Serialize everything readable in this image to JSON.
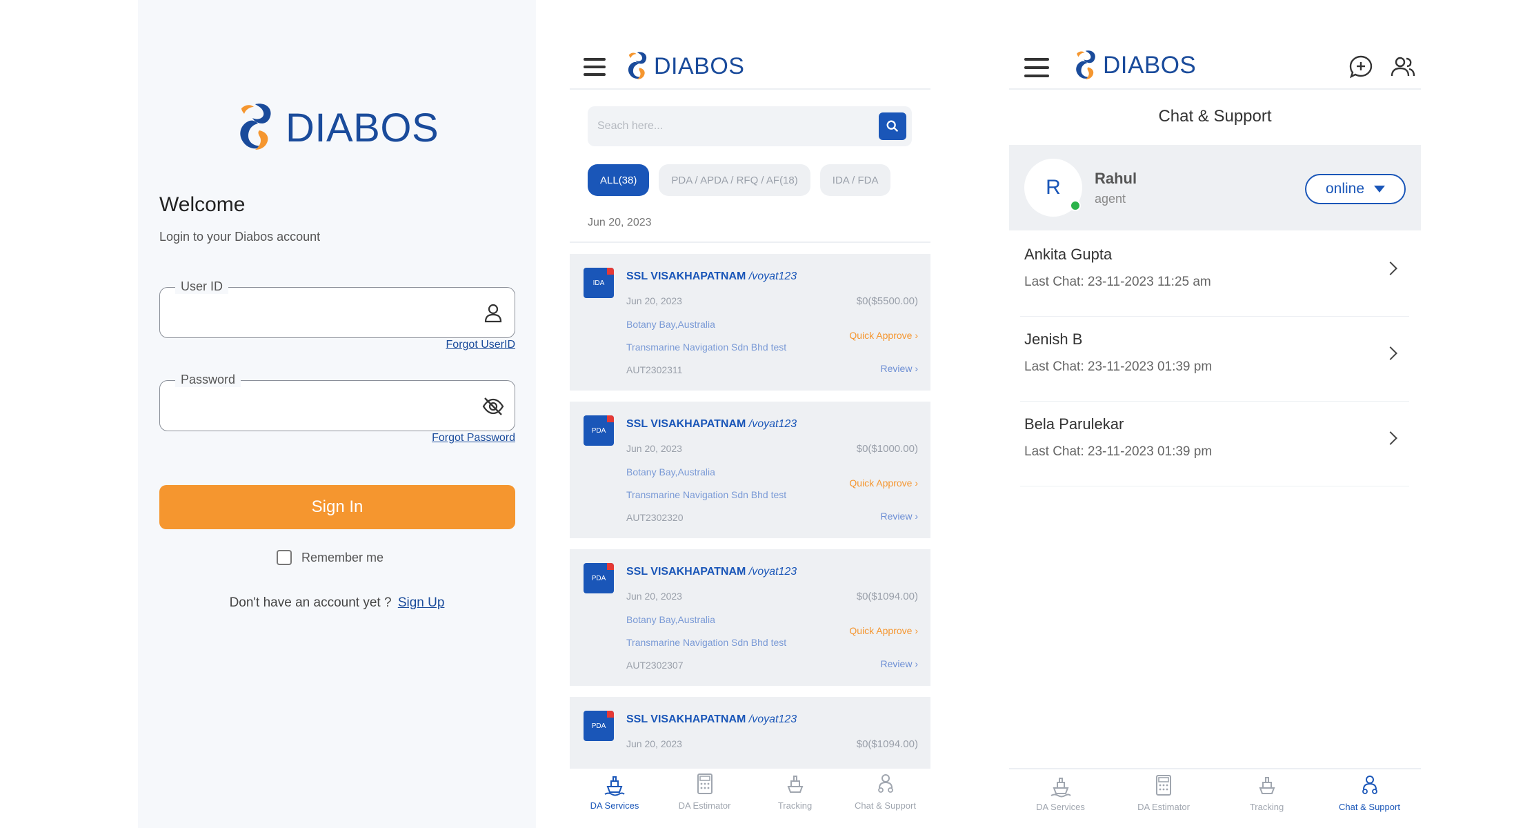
{
  "colors": {
    "brand_blue": "#1a4b9b",
    "accent_blue": "#1a56b8",
    "orange": "#f5962f",
    "online_green": "#2bb34a",
    "bg_light": "#f6f8fb",
    "card_bg": "#eef0f3"
  },
  "logo": {
    "text": "DIABOS"
  },
  "login": {
    "welcome": "Welcome",
    "subtitle": "Login to your Diabos account",
    "userid_label": "User ID",
    "userid_icon": "user-icon",
    "forgot_userid": "Forgot UserID",
    "password_label": "Password",
    "password_icon": "eye-off-icon",
    "forgot_password": "Forgot Password",
    "signin": "Sign In",
    "remember": "Remember me",
    "no_account": "Don't have an account yet ?",
    "signup": "Sign Up"
  },
  "services": {
    "search_placeholder": "Seach here...",
    "filters": [
      "ALL(38)",
      "PDA / APDA / RFQ / AF(18)",
      "IDA / FDA"
    ],
    "date": "Jun 20, 2023",
    "cards": [
      {
        "badge": "IDA",
        "port": "SSL VISAKHAPATNAM",
        "voyage": "/voyat123",
        "date": "Jun 20, 2023",
        "amount": "$0($5500.00)",
        "location": "Botany Bay,Australia",
        "company": "Transmarine Navigation Sdn Bhd test",
        "ref": "AUT2302311",
        "approve": "Quick Approve ›",
        "review": "Review ›"
      },
      {
        "badge": "PDA",
        "port": "SSL VISAKHAPATNAM",
        "voyage": "/voyat123",
        "date": "Jun 20, 2023",
        "amount": "$0($1000.00)",
        "location": "Botany Bay,Australia",
        "company": "Transmarine Navigation Sdn Bhd test",
        "ref": "AUT2302320",
        "approve": "Quick Approve ›",
        "review": "Review ›"
      },
      {
        "badge": "PDA",
        "port": "SSL VISAKHAPATNAM",
        "voyage": "/voyat123",
        "date": "Jun 20, 2023",
        "amount": "$0($1094.00)",
        "location": "Botany Bay,Australia",
        "company": "Transmarine Navigation Sdn Bhd test",
        "ref": "AUT2302307",
        "approve": "Quick Approve ›",
        "review": "Review ›"
      },
      {
        "badge": "PDA",
        "port": "SSL VISAKHAPATNAM",
        "voyage": "/voyat123",
        "date": "Jun 20, 2023",
        "amount": "$0($1094.00)"
      }
    ],
    "tabs": [
      "DA Services",
      "DA Estimator",
      "Tracking",
      "Chat & Support"
    ]
  },
  "chat": {
    "title": "Chat & Support",
    "agent": {
      "initial": "R",
      "name": "Rahul",
      "role": "agent",
      "status": "online"
    },
    "conversations": [
      {
        "name": "Ankita Gupta",
        "last": "Last Chat: 23-11-2023 11:25 am"
      },
      {
        "name": "Jenish B",
        "last": "Last Chat: 23-11-2023 01:39 pm"
      },
      {
        "name": "Bela Parulekar",
        "last": "Last Chat: 23-11-2023 01:39 pm"
      }
    ],
    "tabs": [
      "DA Services",
      "DA Estimator",
      "Tracking",
      "Chat & Support"
    ]
  }
}
